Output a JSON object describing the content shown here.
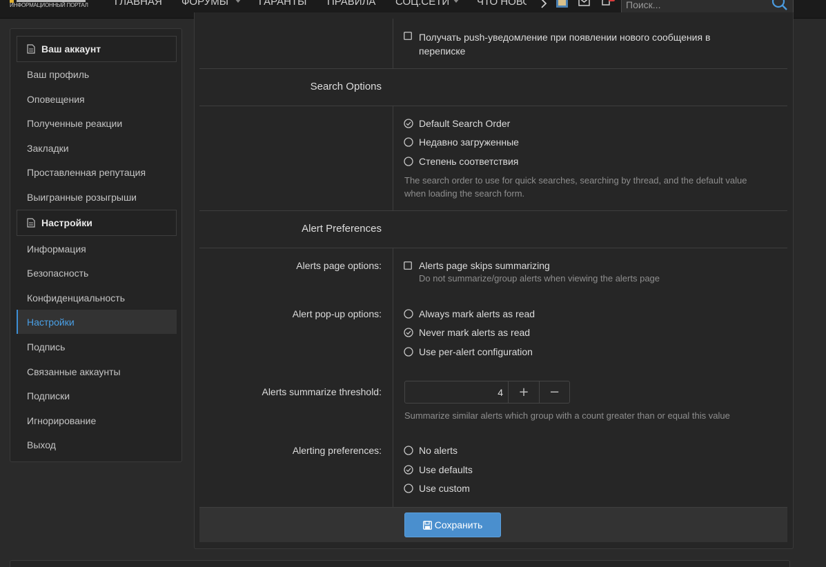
{
  "nav": {
    "logo_subtitle": "ИНФОРМАЦИОННЫЙ ПОРТАЛ",
    "items": [
      "ГЛАВНАЯ",
      "ФОРУМЫ",
      "ГАРАНТЫ",
      "ПРАВИЛА",
      "СОЦ.СЕТИ",
      "ЧТО НОВО"
    ],
    "search_placeholder": "Поиск..."
  },
  "sidebar": {
    "account_header": "Ваш аккаунт",
    "account_items": [
      "Ваш профиль",
      "Оповещения",
      "Полученные реакции",
      "Закладки",
      "Проставленная репутация",
      "Выигранные розыгрыши"
    ],
    "settings_header": "Настройки",
    "settings_items": [
      "Информация",
      "Безопасность",
      "Конфиденциальность",
      "Настройки",
      "Подпись",
      "Связанные аккаунты",
      "Подписки",
      "Игнорирование",
      "Выход"
    ],
    "active_item": "Настройки"
  },
  "main": {
    "push_option": {
      "line1": "Получать push-уведомление при появлении нового сообщения в",
      "line2": "переписке",
      "checked": false
    },
    "search_section": {
      "title": "Search Options",
      "options": [
        {
          "label": "Default Search Order",
          "selected": true
        },
        {
          "label": "Недавно загруженные",
          "selected": false
        },
        {
          "label": "Степень соответствия",
          "selected": false
        }
      ],
      "hint_line1": "The search order to use for quick searches, searching by thread, and the default value",
      "hint_line2": "when loading the search form."
    },
    "alert_section": {
      "title": "Alert Preferences",
      "page_options": {
        "label": "Alerts page options:",
        "checkbox_label": "Alerts page skips summarizing",
        "checked": false,
        "hint": "Do not summarize/group alerts when viewing the alerts page"
      },
      "popup_options": {
        "label": "Alert pop-up options:",
        "options": [
          {
            "label": "Always mark alerts as read",
            "selected": false
          },
          {
            "label": "Never mark alerts as read",
            "selected": true
          },
          {
            "label": "Use per-alert configuration",
            "selected": false
          }
        ]
      },
      "threshold": {
        "label": "Alerts summarize threshold:",
        "value": "4",
        "plus": "+",
        "minus": "−",
        "hint": "Summarize similar alerts which group with a count greater than or equal this value"
      },
      "alerting_prefs": {
        "label": "Alerting preferences:",
        "options": [
          {
            "label": "No alerts",
            "selected": false
          },
          {
            "label": "Use defaults",
            "selected": true
          },
          {
            "label": "Use custom",
            "selected": false
          }
        ]
      }
    },
    "save_label": "Сохранить"
  },
  "colors": {
    "accent": "#4a8fce",
    "active_link": "#4aa0e6",
    "background": "#2a2a2a",
    "panel": "#262626"
  }
}
